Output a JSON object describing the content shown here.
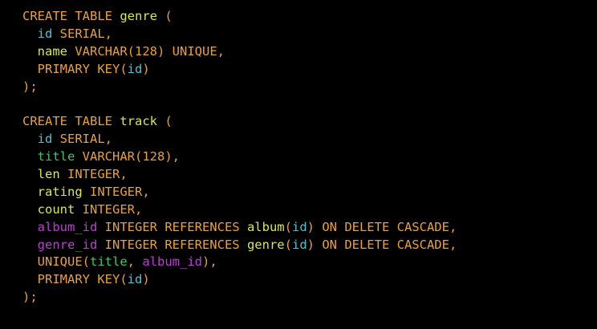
{
  "colors": {
    "background": "#000000",
    "keyword": "#e8a13a",
    "identifier": "#d9e84a",
    "id": "#4fc3d6",
    "number": "#e8a13a",
    "foreign_key": "#c23ad9",
    "title": "#44c26a",
    "punct": "#e8a13a"
  },
  "lines": [
    [
      {
        "t": "CREATE TABLE ",
        "c": "keyword"
      },
      {
        "t": "genre",
        "c": "identifier"
      },
      {
        "t": " (",
        "c": "punct"
      }
    ],
    [
      {
        "t": "  ",
        "c": "punct"
      },
      {
        "t": "id",
        "c": "id"
      },
      {
        "t": " SERIAL,",
        "c": "keyword"
      }
    ],
    [
      {
        "t": "  ",
        "c": "punct"
      },
      {
        "t": "name",
        "c": "identifier"
      },
      {
        "t": " VARCHAR(",
        "c": "keyword"
      },
      {
        "t": "128",
        "c": "number"
      },
      {
        "t": ") UNIQUE,",
        "c": "keyword"
      }
    ],
    [
      {
        "t": "  PRIMARY KEY(",
        "c": "keyword"
      },
      {
        "t": "id",
        "c": "id"
      },
      {
        "t": ")",
        "c": "keyword"
      }
    ],
    [
      {
        "t": ");",
        "c": "punct"
      }
    ],
    [],
    [
      {
        "t": "CREATE TABLE ",
        "c": "keyword"
      },
      {
        "t": "track",
        "c": "identifier"
      },
      {
        "t": " (",
        "c": "punct"
      }
    ],
    [
      {
        "t": "  ",
        "c": "punct"
      },
      {
        "t": "id",
        "c": "id"
      },
      {
        "t": " SERIAL,",
        "c": "keyword"
      }
    ],
    [
      {
        "t": "  ",
        "c": "punct"
      },
      {
        "t": "title",
        "c": "title"
      },
      {
        "t": " VARCHAR(",
        "c": "keyword"
      },
      {
        "t": "128",
        "c": "number"
      },
      {
        "t": "),",
        "c": "keyword"
      }
    ],
    [
      {
        "t": "  ",
        "c": "punct"
      },
      {
        "t": "len",
        "c": "identifier"
      },
      {
        "t": " INTEGER,",
        "c": "keyword"
      }
    ],
    [
      {
        "t": "  ",
        "c": "punct"
      },
      {
        "t": "rating",
        "c": "identifier"
      },
      {
        "t": " INTEGER,",
        "c": "keyword"
      }
    ],
    [
      {
        "t": "  ",
        "c": "punct"
      },
      {
        "t": "count",
        "c": "identifier"
      },
      {
        "t": " INTEGER,",
        "c": "keyword"
      }
    ],
    [
      {
        "t": "  ",
        "c": "punct"
      },
      {
        "t": "album_id",
        "c": "foreign_key"
      },
      {
        "t": " INTEGER REFERENCES ",
        "c": "keyword"
      },
      {
        "t": "album",
        "c": "identifier"
      },
      {
        "t": "(",
        "c": "keyword"
      },
      {
        "t": "id",
        "c": "id"
      },
      {
        "t": ") ON DELETE CASCADE,",
        "c": "keyword"
      }
    ],
    [
      {
        "t": "  ",
        "c": "punct"
      },
      {
        "t": "genre_id",
        "c": "foreign_key"
      },
      {
        "t": " INTEGER REFERENCES ",
        "c": "keyword"
      },
      {
        "t": "genre",
        "c": "identifier"
      },
      {
        "t": "(",
        "c": "keyword"
      },
      {
        "t": "id",
        "c": "id"
      },
      {
        "t": ") ON DELETE CASCADE,",
        "c": "keyword"
      }
    ],
    [
      {
        "t": "  UNIQUE(",
        "c": "keyword"
      },
      {
        "t": "title",
        "c": "title"
      },
      {
        "t": ", ",
        "c": "keyword"
      },
      {
        "t": "album_id",
        "c": "foreign_key"
      },
      {
        "t": "),",
        "c": "keyword"
      }
    ],
    [
      {
        "t": "  PRIMARY KEY(",
        "c": "keyword"
      },
      {
        "t": "id",
        "c": "id"
      },
      {
        "t": ")",
        "c": "keyword"
      }
    ],
    [
      {
        "t": ");",
        "c": "punct"
      }
    ]
  ]
}
